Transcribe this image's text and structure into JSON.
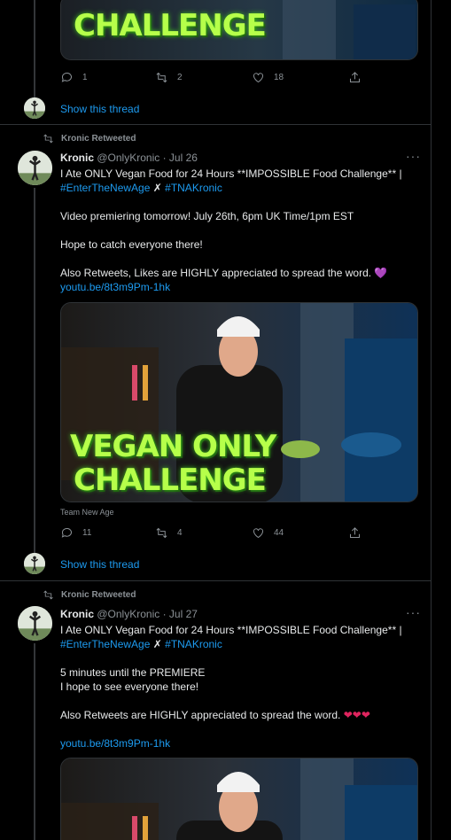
{
  "top_tweet": {
    "thumb_text": "CHALLENGE",
    "replies": "1",
    "retweets": "2",
    "likes": "18",
    "show_thread": "Show this thread"
  },
  "tweets": [
    {
      "retweeted_by": "Kronic Retweeted",
      "name": "Kronic",
      "handle": "@OnlyKronic",
      "date": "· Jul 26",
      "title_line": "I Ate ONLY Vegan Food for 24 Hours **IMPOSSIBLE Food Challenge** |",
      "hashtag1": "#EnterTheNewAge",
      "cross": "✗",
      "hashtag2": "#TNAKronic",
      "line1": "Video premiering tomorrow! July 26th, 6pm UK Time/1pm EST",
      "line2": "Hope to catch everyone there!",
      "line3": "Also Retweets, Likes are HIGHLY appreciated to spread the word.",
      "heart": "💜",
      "url": "youtu.be/8t3m9Pm-1hk",
      "thumb_line1": "VEGAN ONLY",
      "thumb_line2": "CHALLENGE",
      "source": "Team New Age",
      "replies": "11",
      "retweets": "4",
      "likes": "44",
      "show_thread": "Show this thread"
    },
    {
      "retweeted_by": "Kronic Retweeted",
      "name": "Kronic",
      "handle": "@OnlyKronic",
      "date": "· Jul 27",
      "title_line": "I Ate ONLY Vegan Food for 24 Hours **IMPOSSIBLE Food Challenge** |",
      "hashtag1": "#EnterTheNewAge",
      "cross": "✗",
      "hashtag2": "#TNAKronic",
      "line1": "5 minutes until the PREMIERE",
      "line1b": "I hope to see everyone there!",
      "line3": "Also Retweets are HIGHLY appreciated to spread the word.",
      "hearts": "❤❤❤",
      "url": "youtu.be/8t3m9Pm-1hk"
    }
  ],
  "more_label": "···",
  "colors": {
    "link": "#1d9bf0",
    "accent_green": "#b6ff4a",
    "muted": "#8b9196"
  }
}
